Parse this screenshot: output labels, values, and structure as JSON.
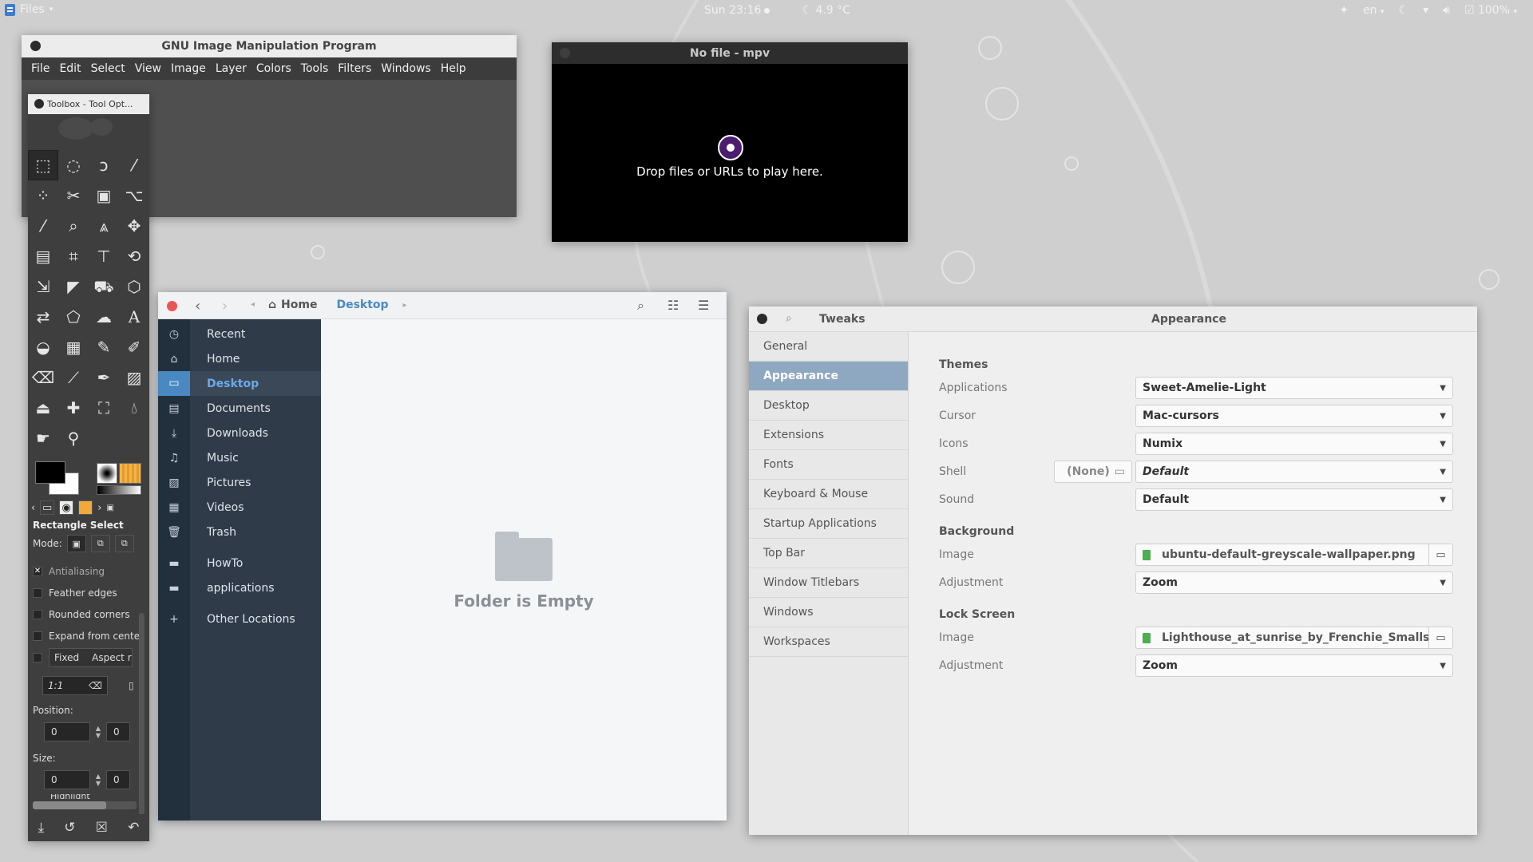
{
  "topbar": {
    "app_menu": "Files",
    "datetime": "Sun 23:16",
    "weather": "4.9 °C",
    "lang": "en",
    "battery": "100%"
  },
  "gimp": {
    "title": "GNU Image Manipulation Program",
    "menu": [
      "File",
      "Edit",
      "Select",
      "View",
      "Image",
      "Layer",
      "Colors",
      "Tools",
      "Filters",
      "Windows",
      "Help"
    ]
  },
  "toolbox": {
    "title": "Toolbox - Tool Opt...",
    "tool_name": "Rectangle Select",
    "mode_label": "Mode:",
    "options": {
      "antialiasing": "Antialiasing",
      "feather": "Feather edges",
      "rounded": "Rounded corners",
      "expand": "Expand from cente",
      "fixed": "Fixed",
      "aspect": "Aspect ra"
    },
    "ratio": "1:1",
    "position_label": "Position:",
    "size_label": "Size:",
    "pos_x": "0",
    "pos_y": "0",
    "size_w": "0",
    "size_h": "0",
    "highlight": "Highlight"
  },
  "mpv": {
    "title": "No file - mpv",
    "message": "Drop files or URLs to play here."
  },
  "files": {
    "path_home": "Home",
    "path_current": "Desktop",
    "sidebar": [
      {
        "label": "Recent",
        "icon": "clock-icon"
      },
      {
        "label": "Home",
        "icon": "home-icon"
      },
      {
        "label": "Desktop",
        "icon": "desktop-icon"
      },
      {
        "label": "Documents",
        "icon": "document-icon"
      },
      {
        "label": "Downloads",
        "icon": "download-icon"
      },
      {
        "label": "Music",
        "icon": "music-icon"
      },
      {
        "label": "Pictures",
        "icon": "picture-icon"
      },
      {
        "label": "Videos",
        "icon": "video-icon"
      },
      {
        "label": "Trash",
        "icon": "trash-icon"
      },
      {
        "label": "HowTo",
        "icon": "folder-icon"
      },
      {
        "label": "applications",
        "icon": "folder-icon"
      },
      {
        "label": "Other Locations",
        "icon": "plus-icon"
      }
    ],
    "empty_message": "Folder is Empty"
  },
  "tweaks": {
    "app_title": "Tweaks",
    "section_title": "Appearance",
    "sidebar": [
      "General",
      "Appearance",
      "Desktop",
      "Extensions",
      "Fonts",
      "Keyboard & Mouse",
      "Startup Applications",
      "Top Bar",
      "Window Titlebars",
      "Windows",
      "Workspaces"
    ],
    "themes_heading": "Themes",
    "applications_label": "Applications",
    "applications_value": "Sweet-Amelie-Light",
    "cursor_label": "Cursor",
    "cursor_value": "Mac-cursors",
    "icons_label": "Icons",
    "icons_value": "Numix",
    "shell_label": "Shell",
    "shell_none": "(None)",
    "shell_value": "Default",
    "sound_label": "Sound",
    "sound_value": "Default",
    "background_heading": "Background",
    "bg_image_label": "Image",
    "bg_image_value": "ubuntu-default-greyscale-wallpaper.png",
    "bg_adjust_label": "Adjustment",
    "bg_adjust_value": "Zoom",
    "lock_heading": "Lock Screen",
    "lock_image_label": "Image",
    "lock_image_value": "Lighthouse_at_sunrise_by_Frenchie_Smalls.jpg",
    "lock_adjust_label": "Adjustment",
    "lock_adjust_value": "Zoom"
  }
}
